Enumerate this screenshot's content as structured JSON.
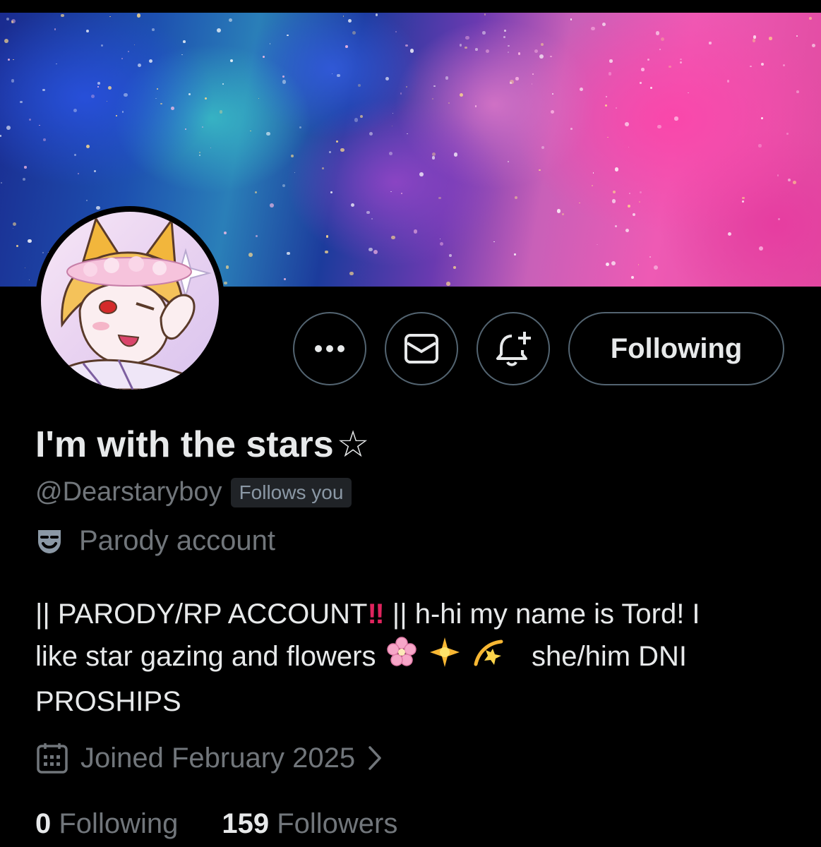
{
  "profile": {
    "display_name": "I'm with the stars",
    "handle": "@Dearstaryboy",
    "follows_you_badge": "Follows you",
    "parody_label": "Parody account",
    "bio_lines": [
      "|| PARODY/RP ACCOUNT",
      "|| h-hi my name is Tord! I",
      "like star gazing and flowers",
      "she/him DNI",
      "PROSHIPS"
    ],
    "joined": "Joined February 2025",
    "following_count": "0",
    "following_label": "Following",
    "followers_count": "159",
    "followers_label": "Followers"
  },
  "actions": {
    "more_icon": "more-horizontal-icon",
    "message_icon": "envelope-icon",
    "notify_icon": "bell-plus-icon",
    "following_button_label": "Following"
  },
  "colors": {
    "background": "#000000",
    "primary_text": "#e7e9ea",
    "secondary_text": "#71767b",
    "border": "#536471",
    "badge_bg": "#202327",
    "alert_red": "#e0245e"
  }
}
